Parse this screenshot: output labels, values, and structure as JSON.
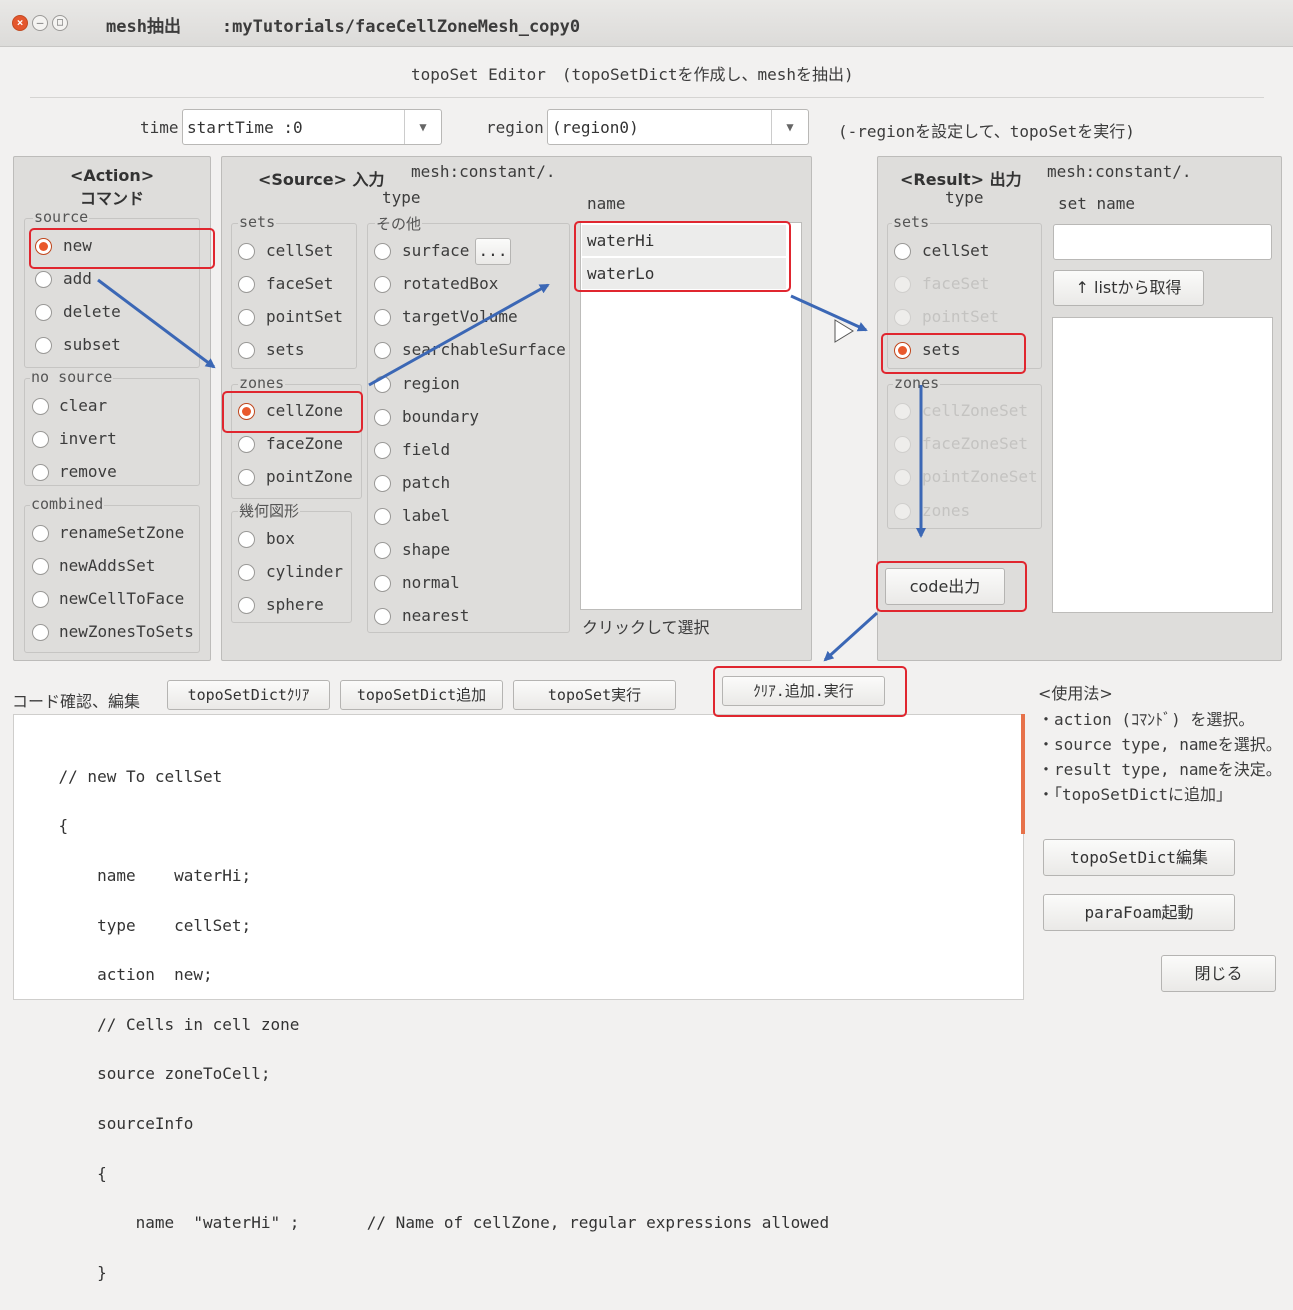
{
  "window": {
    "title": "mesh抽出",
    "path": ":myTutorials/faceCellZoneMesh_copy0"
  },
  "heading": "topoSet Editor　(topoSetDictを作成し、meshを抽出)",
  "time": {
    "label": "time",
    "value": "startTime :0"
  },
  "region": {
    "label": "region",
    "value": "(region0)",
    "hint": "(-regionを設定して、topoSetを実行)"
  },
  "action": {
    "title1": "<Action>",
    "title2": "コマンド",
    "groups": [
      {
        "label": "source",
        "items": [
          "new",
          "add",
          "delete",
          "subset"
        ]
      },
      {
        "label": "no source",
        "items": [
          "clear",
          "invert",
          "remove"
        ]
      },
      {
        "label": "combined",
        "items": [
          "renameSetZone",
          "newAddsSet",
          "newCellToFace",
          "newZonesToSets"
        ]
      }
    ],
    "selected": "new"
  },
  "source": {
    "title": "<Source> 入力",
    "mesh": "mesh:constant/.",
    "type_label": "type",
    "sets_label": "sets",
    "sets": [
      "cellSet",
      "faceSet",
      "pointSet",
      "sets"
    ],
    "zones_label": "zones",
    "zones": [
      "cellZone",
      "faceZone",
      "pointZone"
    ],
    "geom_label": "幾何図形",
    "geom": [
      "box",
      "cylinder",
      "sphere"
    ],
    "other_label": "その他",
    "other": [
      "surface",
      "rotatedBox",
      "targetVolume",
      "searchableSurface",
      "region",
      "boundary",
      "field",
      "patch",
      "label",
      "shape",
      "normal",
      "nearest"
    ],
    "surface_btn": "...",
    "selected": "cellZone",
    "name_label": "name",
    "names": [
      "waterHi",
      "waterLo"
    ],
    "click_hint": "クリックして選択"
  },
  "result": {
    "title": "<Result> 出力",
    "mesh": "mesh:constant/.",
    "type_label": "type",
    "sets_label": "sets",
    "sets": [
      "cellSet",
      "faceSet",
      "pointSet",
      "sets"
    ],
    "zones_label": "zones",
    "zones": [
      "cellZoneSet",
      "faceZoneSet",
      "pointZoneSet",
      "zones"
    ],
    "selected": "sets",
    "set_name_label": "set name",
    "set_name_value": "",
    "list_btn": "↑ listから取得",
    "code_btn": "code出力"
  },
  "toolbar": {
    "label": "コード確認、編集",
    "clear": "topoSetDictｸﾘｱ",
    "add": "topoSetDict追加",
    "run": "topoSet実行",
    "all": "ｸﾘｱ.追加.実行"
  },
  "code_lines": [
    "    // new To cellSet",
    "    {",
    "        name    waterHi;",
    "        type    cellSet;",
    "        action  new;",
    "        // Cells in cell zone",
    "        source zoneToCell;",
    "        sourceInfo",
    "        {",
    "            name  \"waterHi\" ;       // Name of cellZone, regular expressions allowed",
    "        }"
  ],
  "usage": {
    "title": "<使用法>",
    "lines": [
      "・action (ｺﾏﾝﾄﾞ) を選択。",
      "・source type, nameを選択。",
      "・result type, nameを決定。",
      "・「topoSetDictに追加」"
    ]
  },
  "side_buttons": {
    "edit": "topoSetDict編集",
    "parafoam": "paraFoam起動",
    "close": "閉じる"
  }
}
